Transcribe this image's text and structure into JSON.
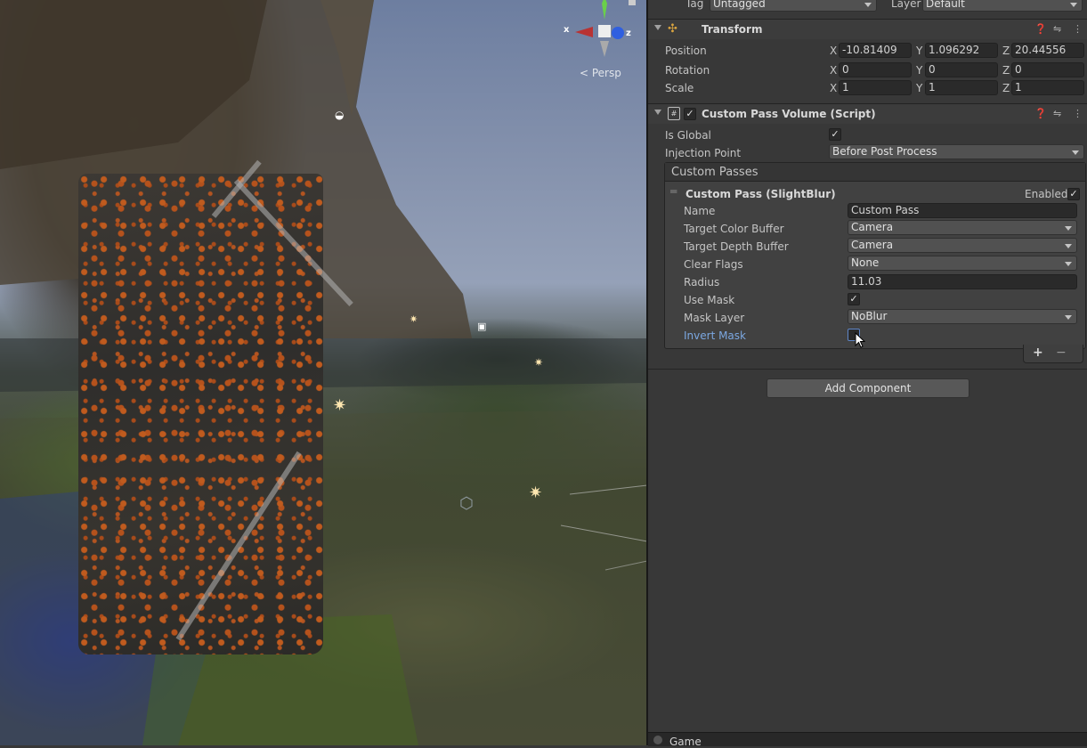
{
  "scene": {
    "gizmo_label": "< Persp",
    "gizmo_x": "x",
    "gizmo_z": "z"
  },
  "header_row": {
    "tag_label": "Tag",
    "tag_value": "Untagged",
    "layer_label": "Layer",
    "layer_value": "Default"
  },
  "transform": {
    "title": "Transform",
    "position": {
      "label": "Position",
      "x": "-10.81409",
      "y": "1.096292",
      "z": "20.44556"
    },
    "rotation": {
      "label": "Rotation",
      "x": "0",
      "y": "0",
      "z": "0"
    },
    "scale": {
      "label": "Scale",
      "x": "1",
      "y": "1",
      "z": "1"
    },
    "axes": {
      "x": "X",
      "y": "Y",
      "z": "Z"
    }
  },
  "custom_pass_volume": {
    "title": "Custom Pass Volume (Script)",
    "is_global_label": "Is Global",
    "is_global": true,
    "injection_point_label": "Injection Point",
    "injection_point_value": "Before Post Process",
    "custom_passes_label": "Custom Passes",
    "pass": {
      "title": "Custom Pass (SlightBlur)",
      "enabled_label": "Enabled",
      "enabled": true,
      "name_label": "Name",
      "name_value": "Custom Pass",
      "target_color_label": "Target Color Buffer",
      "target_color_value": "Camera",
      "target_depth_label": "Target Depth Buffer",
      "target_depth_value": "Camera",
      "clear_flags_label": "Clear Flags",
      "clear_flags_value": "None",
      "radius_label": "Radius",
      "radius_value": "11.03",
      "use_mask_label": "Use Mask",
      "use_mask": true,
      "mask_layer_label": "Mask Layer",
      "mask_layer_value": "NoBlur",
      "invert_mask_label": "Invert Mask",
      "invert_mask": false
    },
    "plus": "+",
    "minus": "−"
  },
  "add_component_label": "Add Component",
  "bottom_tab": {
    "label": "Game"
  },
  "colors": {
    "accent_label": "#7ba7e0",
    "panel_bg": "#383838"
  },
  "icons": {
    "help": "help-icon",
    "presets": "presets-icon",
    "menu": "kebab-menu-icon",
    "transform": "transform-icon",
    "script": "script-icon"
  }
}
